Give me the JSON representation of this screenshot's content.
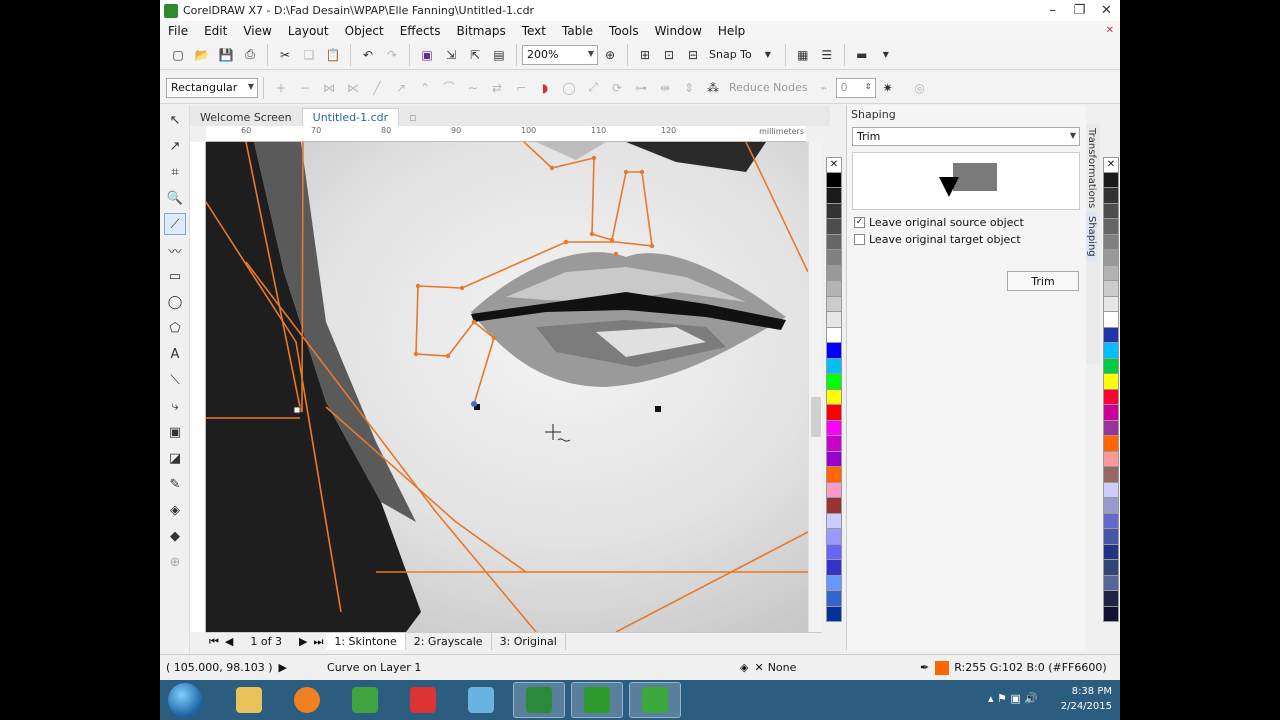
{
  "window": {
    "title": "CorelDRAW X7 - D:\\Fad Desain\\WPAP\\Elle Fanning\\Untitled-1.cdr"
  },
  "menu": [
    "File",
    "Edit",
    "View",
    "Layout",
    "Object",
    "Effects",
    "Bitmaps",
    "Text",
    "Table",
    "Tools",
    "Window",
    "Help"
  ],
  "standard_toolbar": {
    "zoom": "200%",
    "snap_to": "Snap To"
  },
  "property_bar": {
    "mode": "Rectangular",
    "reduce_nodes": "Reduce Nodes",
    "smoothing": "0"
  },
  "doc_tabs": [
    "Welcome Screen",
    "Untitled-1.cdr"
  ],
  "ruler": {
    "ticks": [
      "60",
      "70",
      "80",
      "90",
      "100",
      "110",
      "120"
    ],
    "unit": "millimeters"
  },
  "docker": {
    "title": "Shaping",
    "mode": "Trim",
    "options": [
      {
        "label": "Leave original source object",
        "checked": true
      },
      {
        "label": "Leave original target object",
        "checked": false
      }
    ],
    "apply_label": "Trim",
    "side_tabs": [
      "Transformations",
      "Shaping"
    ]
  },
  "page_nav": {
    "page": "1 of 3",
    "pages": [
      "1: Skintone",
      "2: Grayscale",
      "3: Original"
    ]
  },
  "status": {
    "coords": "( 105.000, 98.103 )",
    "object": "Curve on Layer 1",
    "fill": "None",
    "outline_color": "R:255 G:102 B:0 (#FF6600)",
    "outline_hex": "#FF6600"
  },
  "palette_left": [
    "#000000",
    "#1a1a1a",
    "#333333",
    "#4d4d4d",
    "#666666",
    "#808080",
    "#999999",
    "#b3b3b3",
    "#cccccc",
    "#e6e6e6",
    "#ffffff",
    "#0000ff",
    "#00bfff",
    "#00ff00",
    "#ffff00",
    "#ff0000",
    "#ff00ff",
    "#cc00cc",
    "#9900cc",
    "#ff6600",
    "#ff99cc",
    "#993333",
    "#ccccff",
    "#9999ff",
    "#6666ff",
    "#3333cc",
    "#6699ff",
    "#3366cc",
    "#003399"
  ],
  "palette_right": [
    "#1a1a1a",
    "#333333",
    "#4d4d4d",
    "#666666",
    "#808080",
    "#999999",
    "#b3b3b3",
    "#cccccc",
    "#e6e6e6",
    "#ffffff",
    "#2233aa",
    "#00bfff",
    "#00cc44",
    "#ffff00",
    "#ff0033",
    "#cc0099",
    "#993399",
    "#ff6600",
    "#ff9999",
    "#996666",
    "#ccccff",
    "#9999cc",
    "#6666cc",
    "#4455aa",
    "#223388",
    "#334477",
    "#556699",
    "#222244",
    "#111133"
  ],
  "tray": {
    "time": "8:38 PM",
    "date": "2/24/2015"
  }
}
